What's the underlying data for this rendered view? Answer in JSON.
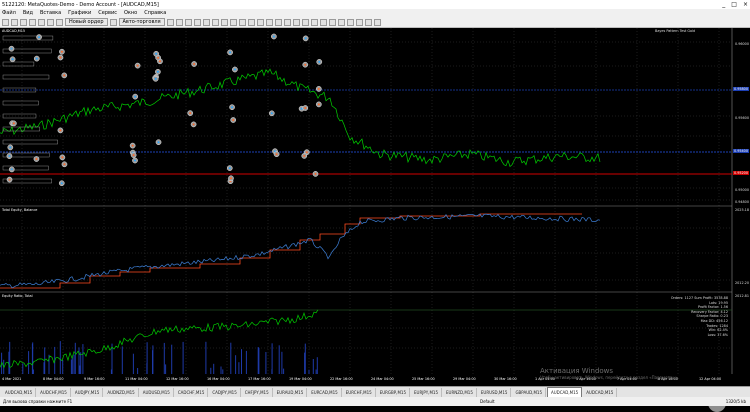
{
  "window": {
    "title": "5122120: MetaQuotes-Demo - Demo Account - [AUDCAD,M15]",
    "controls": [
      "_",
      "□",
      "×"
    ]
  },
  "menu": [
    "Файл",
    "Вид",
    "Вставка",
    "Графики",
    "Сервис",
    "Окно",
    "Справка"
  ],
  "toolbar": {
    "new_order": "Новый ордер",
    "autotrading": "Авто-торговля"
  },
  "chart": {
    "top_info": "AUDCAD,M15",
    "top_right_info": "Bayes Pattern Test Gold",
    "indicator1_label": "Total Equity, Balance",
    "indicator2_label": "Equity Ratio, Total",
    "price_labels": [
      "0.96000",
      "0.95800",
      "0.95600",
      "0.95400",
      "0.95200",
      "0.95000",
      "0.94800"
    ],
    "panel_label_top": "2025.18",
    "panel_label_mid": "2012.20",
    "panel_label_bottom": "2012.81",
    "stats_lines": [
      "Orders: 1127 Sum Profit: 3578.88",
      "Lots: 19.95",
      "Profit Factor: 1.56",
      "Recovery Factor: 4.12",
      "Sharpe Ratio: 0.23",
      "Max DD: 456.12",
      "Trades: 1284",
      "Win: 62.4%",
      "Loss: 37.6%"
    ],
    "time_labels": [
      "4 Mar 2021",
      "8 Mar 04:00",
      "9 Mar 16:00",
      "11 Mar 04:00",
      "12 Mar 16:00",
      "16 Mar 04:00",
      "17 Mar 16:00",
      "19 Mar 04:00",
      "22 Mar 16:00",
      "24 Mar 04:00",
      "25 Mar 16:00",
      "29 Mar 04:00",
      "30 Mar 16:00",
      "1 Apr 04:00",
      "5 Apr 16:00",
      "7 Apr 04:00",
      "8 Apr 16:00",
      "12 Apr 04:00"
    ]
  },
  "watermark": {
    "line1": "Активация Windows",
    "line2": "Чтобы активировать Windows, перейдите в раздел «Параметры»."
  },
  "tabs": [
    "AUDCAD,M15",
    "AUDCHF,M15",
    "AUDJPY,M15",
    "AUDNZD,M15",
    "AUDUSD,M15",
    "CADCHF,M15",
    "CADJPY,M15",
    "CHFJPY,M15",
    "EURAUD,M15",
    "EURCAD,M15",
    "EURCHF,M15",
    "EURGBP,M15",
    "EURJPY,M15",
    "EURNZD,M15",
    "EURUSD,M15",
    "GBPAUD,M15",
    "AUDCAD,M15",
    "AUDCAD,M15"
  ],
  "active_tab_index": 16,
  "status": {
    "left": "Для вызова справки нажмите F1",
    "mid": "Default",
    "right": "1320/5 kb"
  },
  "colors": {
    "price_line": "#00d000",
    "balance_line": "#ff4b1f",
    "equity_line": "#3d7fd6",
    "ratio_line": "#00cc00",
    "grid": "#3a3a3a",
    "blue_level": "#1c3fb5",
    "red_level": "#d00000"
  }
}
